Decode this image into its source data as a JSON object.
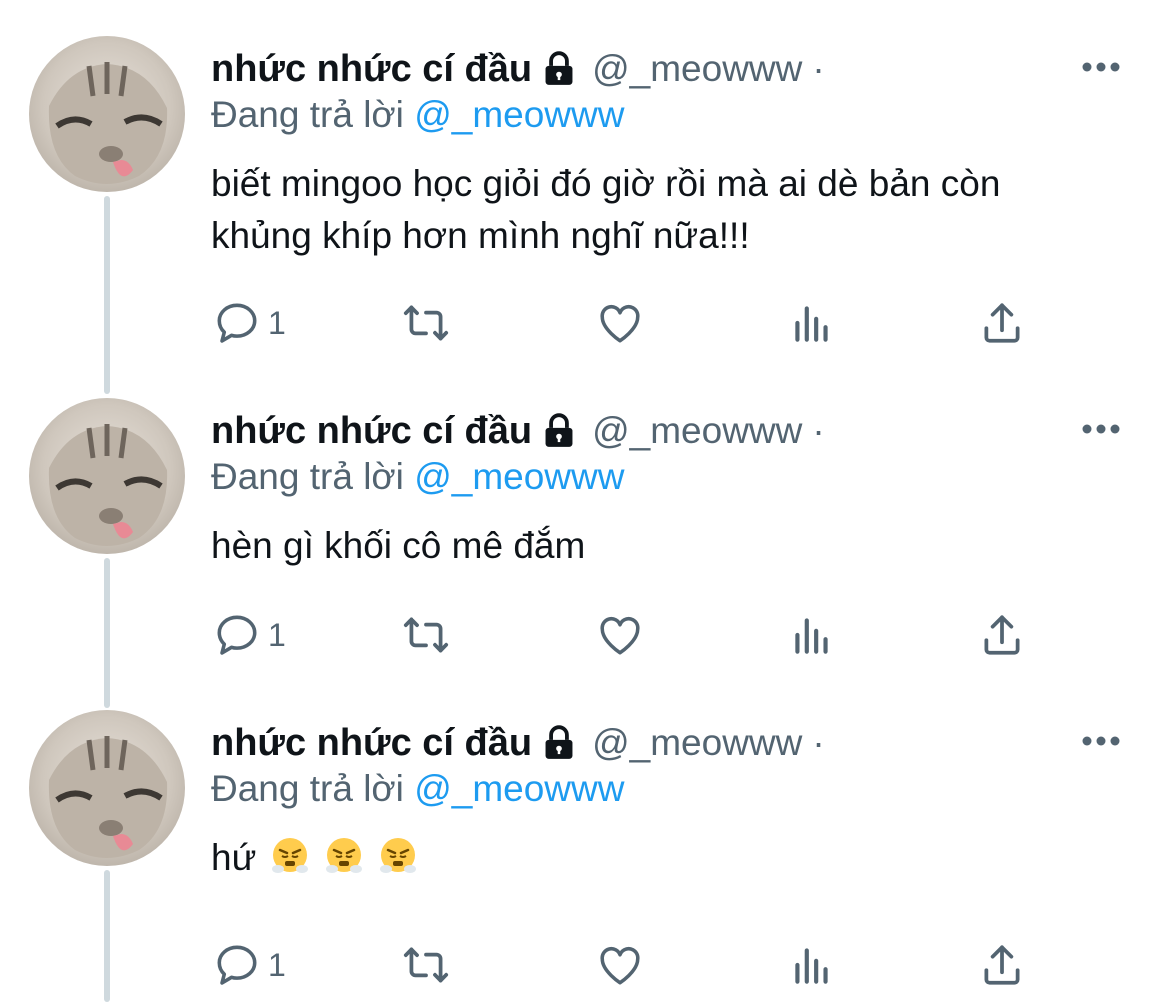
{
  "tweets": [
    {
      "display_name": "nhức nhức cí đầu",
      "handle": "@_meowww",
      "separator": "·",
      "reply_prefix": "Đang trả lời",
      "reply_to": "@_meowww",
      "text": "biết mingoo học giỏi đó giờ rồi mà ai dè bản còn khủng khíp hơn mình nghĩ nữa!!!",
      "reply_count": "1"
    },
    {
      "display_name": "nhức nhức cí đầu",
      "handle": "@_meowww",
      "separator": "·",
      "reply_prefix": "Đang trả lời",
      "reply_to": "@_meowww",
      "text": "hèn gì khối cô mê đắm",
      "reply_count": "1"
    },
    {
      "display_name": "nhức nhức cí đầu",
      "handle": "@_meowww",
      "separator": "·",
      "reply_prefix": "Đang trả lời",
      "reply_to": "@_meowww",
      "text": "hứ",
      "emojis": [
        "huffing-face-emoji",
        "huffing-face-emoji",
        "huffing-face-emoji"
      ],
      "reply_count": "1"
    }
  ],
  "icons": {
    "lock": "lock-icon",
    "more": "more-icon",
    "reply": "reply-icon",
    "retweet": "retweet-icon",
    "like": "heart-icon",
    "views": "analytics-icon",
    "share": "share-icon"
  },
  "colors": {
    "text_primary": "#0f1419",
    "text_secondary": "#536471",
    "link": "#1d9bf0",
    "thread_line": "#cfd9de"
  }
}
